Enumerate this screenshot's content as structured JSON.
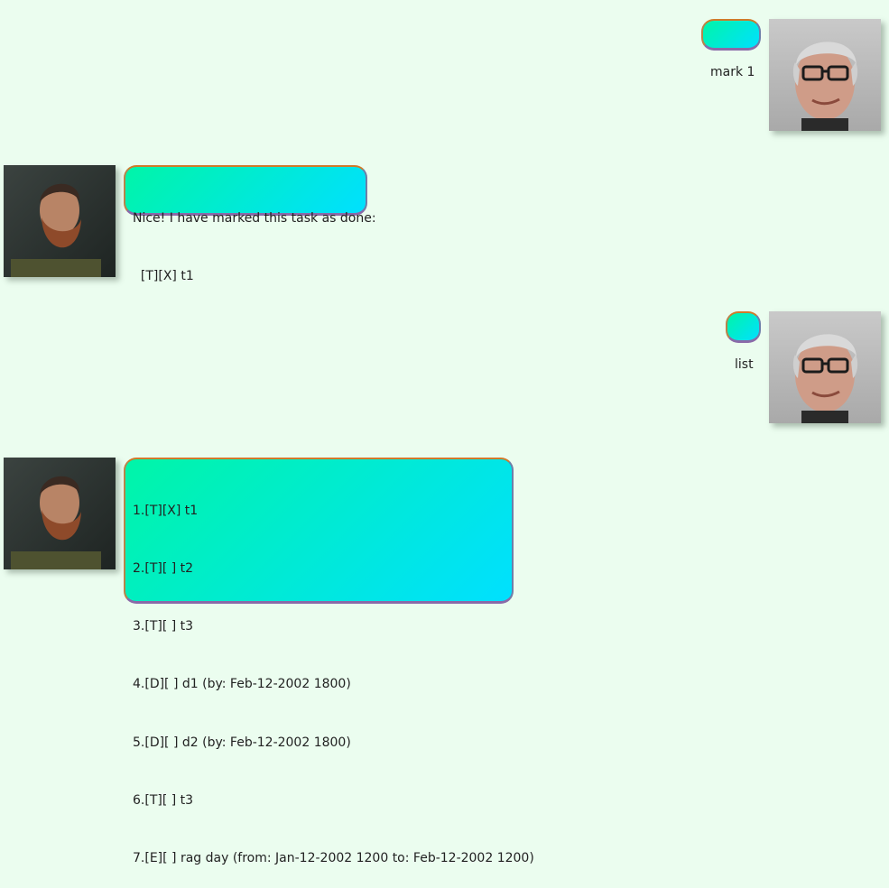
{
  "conversation": {
    "messages": [
      {
        "sender": "user",
        "text": "mark 1",
        "avatar_icon": "user-avatar"
      },
      {
        "sender": "bot",
        "lines": [
          "Nice! I have marked this task as done:",
          "  [T][X] t1"
        ],
        "avatar_icon": "bot-avatar"
      },
      {
        "sender": "user",
        "text": "list",
        "avatar_icon": "user-avatar"
      },
      {
        "sender": "bot",
        "lines": [
          "1.[T][X] t1",
          "2.[T][ ] t2",
          "3.[T][ ] t3",
          "4.[D][ ] d1 (by: Feb-12-2002 1800)",
          "5.[D][ ] d2 (by: Feb-12-2002 1800)",
          "6.[T][ ] t3",
          "7.[E][ ] rag day (from: Jan-12-2002 1200 to: Feb-12-2002 1200)"
        ],
        "avatar_icon": "bot-avatar"
      }
    ]
  },
  "colors": {
    "background": "#ebfdef",
    "bubble_gradient_start": "#00f5a8",
    "bubble_gradient_end": "#00e0ff"
  }
}
